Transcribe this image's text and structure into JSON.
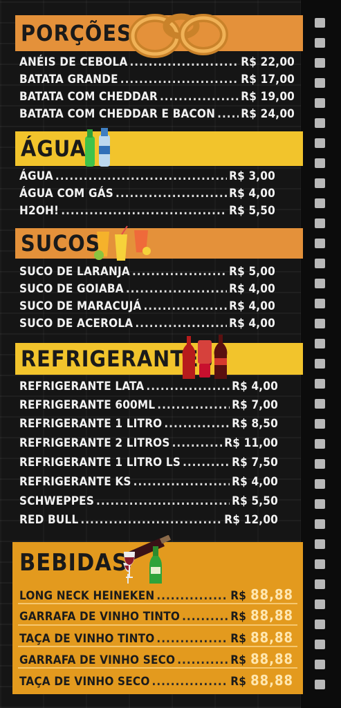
{
  "colors": {
    "orange_banner": "#e4913a",
    "yellow_banner": "#f2c42c",
    "bebidas_panel": "#e39a1e",
    "background": "#151515"
  },
  "icons": [
    "onion-rings-icon",
    "water-bottles-icon",
    "juice-glasses-icon",
    "soda-bottles-icon",
    "wine-bottle-icon",
    "wine-glass-icon",
    "beer-bottle-icon"
  ],
  "sections": [
    {
      "title": "PORÇÕES",
      "items": [
        {
          "name": "ANÉIS DE CEBOLA",
          "price": "R$ 22,00"
        },
        {
          "name": "BATATA GRANDE",
          "price": "R$ 17,00"
        },
        {
          "name": "BATATA COM CHEDDAR",
          "price": "R$ 19,00"
        },
        {
          "name": "BATATA COM CHEDDAR E BACON",
          "price": "R$ 24,00"
        }
      ]
    },
    {
      "title": "ÁGUA",
      "items": [
        {
          "name": "ÁGUA",
          "price": "R$ 3,00"
        },
        {
          "name": "ÁGUA COM GÁS",
          "price": "R$ 4,00"
        },
        {
          "name": "H2OH!",
          "price": "R$ 5,50"
        }
      ]
    },
    {
      "title": "SUCOS",
      "items": [
        {
          "name": "SUCO DE LARANJA",
          "price": "R$ 5,00"
        },
        {
          "name": "SUCO DE GOIABA",
          "price": "R$ 4,00"
        },
        {
          "name": "SUCO DE MARACUJÁ",
          "price": "R$ 4,00"
        },
        {
          "name": "SUCO DE ACEROLA",
          "price": "R$ 4,00"
        }
      ]
    },
    {
      "title": "REFRIGERANTES",
      "items": [
        {
          "name": "REFRIGERANTE LATA",
          "price": "R$ 4,00"
        },
        {
          "name": "REFRIGERANTE 600ML",
          "price": "R$ 7,00"
        },
        {
          "name": "REFRIGERANTE 1 LITRO",
          "price": "R$ 8,50"
        },
        {
          "name": "REFRIGERANTE 2 LITROS",
          "price": "R$ 11,00"
        },
        {
          "name": "REFRIGERANTE 1 LITRO LS",
          "price": "R$ 7,50"
        },
        {
          "name": "REFRIGERANTE KS",
          "price": "R$ 4,00"
        },
        {
          "name": "SCHWEPPES",
          "price": "R$ 5,50"
        },
        {
          "name": "RED BULL",
          "price": "R$ 12,00"
        }
      ]
    },
    {
      "title": "BEBIDAS",
      "items": [
        {
          "name": "LONG NECK HEINEKEN",
          "currency": "R$",
          "price": "88,88"
        },
        {
          "name": "GARRAFA DE VINHO TINTO",
          "currency": "R$",
          "price": "88,88"
        },
        {
          "name": "TAÇA DE VINHO TINTO",
          "currency": "R$",
          "price": "88,88"
        },
        {
          "name": "GARRAFA DE VINHO SECO",
          "currency": "R$",
          "price": "88,88"
        },
        {
          "name": "TAÇA DE VINHO SECO",
          "currency": "R$",
          "price": "88,88"
        }
      ]
    }
  ]
}
